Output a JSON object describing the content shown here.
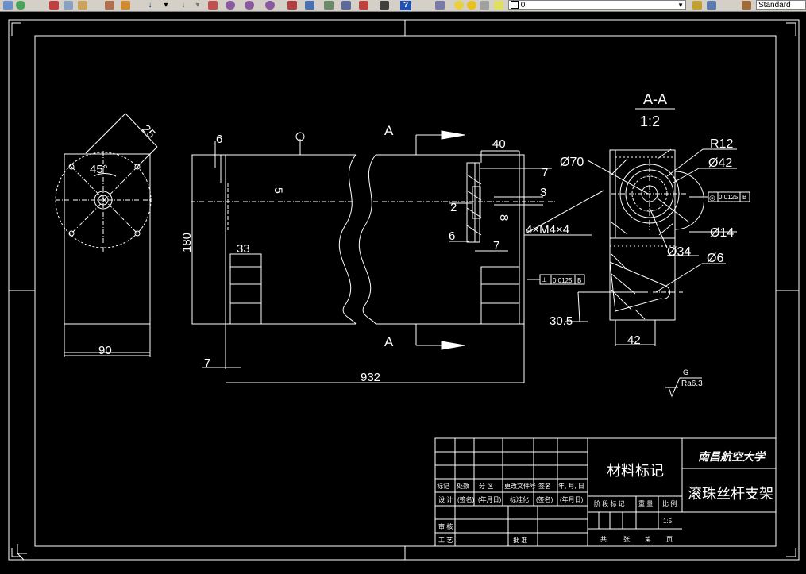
{
  "toolbar": {
    "layer_value": "0",
    "textstyle_value": "Standard"
  },
  "drawing": {
    "left_view": {
      "radius_dim": "25",
      "angle_dim": "45°",
      "width_dim": "90"
    },
    "main_view": {
      "section_letter_top": "A",
      "section_letter_bottom": "A",
      "dim_6": "6",
      "dim_40": "40",
      "dim_7a": "7",
      "dim_3": "3",
      "dim_2": "2",
      "dim_8": "8",
      "dim_6b": "6",
      "dim_7b": "7",
      "dim_5": "5",
      "dim_180": "180",
      "dim_33": "33",
      "dim_7c": "7",
      "dim_932": "932",
      "thread_note": "4×M4×4",
      "tolerance_value": "0.0125",
      "datum": "B"
    },
    "section_view": {
      "title": "A-A",
      "scale": "1:2",
      "dia_70": "Ø70",
      "r12": "R12",
      "dia_42": "Ø42",
      "dia_14": "Ø14",
      "dia_34": "Ø34",
      "dia_6": "Ø6",
      "dim_30_5": "30.5",
      "dim_42": "42",
      "tolerance_value": "0.0125",
      "datum": "B"
    },
    "roughness": {
      "letter": "G",
      "value": "Ra6.3"
    },
    "title_block": {
      "material_label": "材料标记",
      "university": "南昌航空大学",
      "part_name": "滚珠丝杆支架",
      "scale_value": "1:5",
      "row_labels": [
        "标记",
        "处数",
        "分 区",
        "更改文件号",
        "签名",
        "年, 月, 日"
      ],
      "row2_labels": [
        "设 计",
        "(签名)",
        "(年月日)",
        "标准化",
        "(签名)",
        "(年月日)"
      ],
      "stage_labels": [
        "阶 段 标 记",
        "重 量",
        "比 例"
      ],
      "review_label": "审 核",
      "process_label": "工 艺",
      "approve_label": "批 准",
      "sheet_labels": [
        "共",
        "张",
        "第",
        "页"
      ]
    }
  }
}
